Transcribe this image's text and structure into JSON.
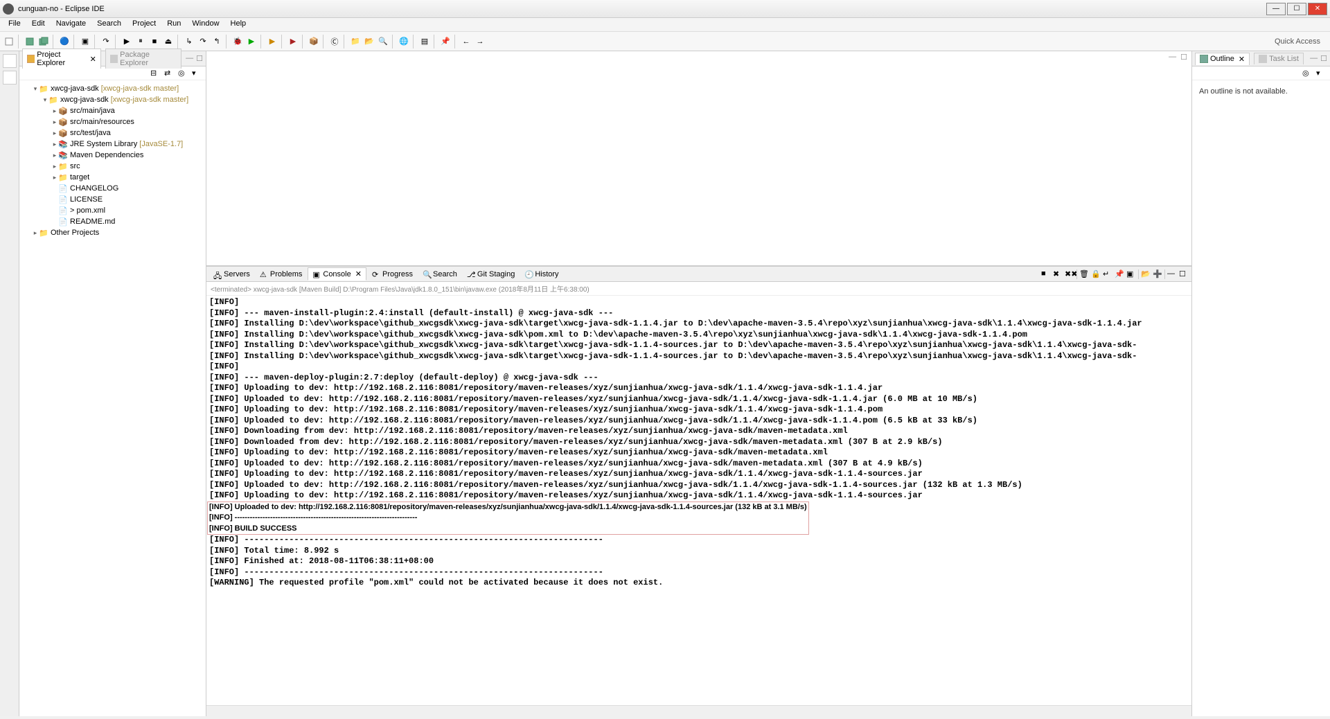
{
  "title": "cunguan-no - Eclipse IDE",
  "menu": [
    "File",
    "Edit",
    "Navigate",
    "Search",
    "Project",
    "Run",
    "Window",
    "Help"
  ],
  "quickAccess": "Quick Access",
  "leftTabs": {
    "projectExplorer": "Project Explorer",
    "packageExplorer": "Package Explorer"
  },
  "tree": {
    "proj1": "xwcg-java-sdk",
    "proj1b": "[xwcg-java-sdk master]",
    "proj2": "xwcg-java-sdk",
    "proj2b": "[xwcg-java-sdk master]",
    "srcMainJava": "src/main/java",
    "srcMainRes": "src/main/resources",
    "srcTestJava": "src/test/java",
    "jre": "JRE System Library",
    "jreb": "[JavaSE-1.7]",
    "maven": "Maven Dependencies",
    "src": "src",
    "target": "target",
    "changelog": "CHANGELOG",
    "license": "LICENSE",
    "pom": "> pom.xml",
    "readme": "README.md",
    "other": "Other Projects"
  },
  "ctabs": {
    "servers": "Servers",
    "problems": "Problems",
    "console": "Console",
    "progress": "Progress",
    "search": "Search",
    "git": "Git Staging",
    "history": "History"
  },
  "terminated": "<terminated> xwcg-java-sdk [Maven Build] D:\\Program Files\\Java\\jdk1.8.0_151\\bin\\javaw.exe (2018年8月11日 上午6:38:00)",
  "lines": [
    "[INFO]",
    "[INFO] --- maven-install-plugin:2.4:install (default-install) @ xwcg-java-sdk ---",
    "[INFO] Installing D:\\dev\\workspace\\github_xwcgsdk\\xwcg-java-sdk\\target\\xwcg-java-sdk-1.1.4.jar to D:\\dev\\apache-maven-3.5.4\\repo\\xyz\\sunjianhua\\xwcg-java-sdk\\1.1.4\\xwcg-java-sdk-1.1.4.jar",
    "[INFO] Installing D:\\dev\\workspace\\github_xwcgsdk\\xwcg-java-sdk\\pom.xml to D:\\dev\\apache-maven-3.5.4\\repo\\xyz\\sunjianhua\\xwcg-java-sdk\\1.1.4\\xwcg-java-sdk-1.1.4.pom",
    "[INFO] Installing D:\\dev\\workspace\\github_xwcgsdk\\xwcg-java-sdk\\target\\xwcg-java-sdk-1.1.4-sources.jar to D:\\dev\\apache-maven-3.5.4\\repo\\xyz\\sunjianhua\\xwcg-java-sdk\\1.1.4\\xwcg-java-sdk-",
    "[INFO] Installing D:\\dev\\workspace\\github_xwcgsdk\\xwcg-java-sdk\\target\\xwcg-java-sdk-1.1.4-sources.jar to D:\\dev\\apache-maven-3.5.4\\repo\\xyz\\sunjianhua\\xwcg-java-sdk\\1.1.4\\xwcg-java-sdk-",
    "[INFO]",
    "[INFO] --- maven-deploy-plugin:2.7:deploy (default-deploy) @ xwcg-java-sdk ---",
    "[INFO] Uploading to dev: http://192.168.2.116:8081/repository/maven-releases/xyz/sunjianhua/xwcg-java-sdk/1.1.4/xwcg-java-sdk-1.1.4.jar",
    "[INFO] Uploaded to dev: http://192.168.2.116:8081/repository/maven-releases/xyz/sunjianhua/xwcg-java-sdk/1.1.4/xwcg-java-sdk-1.1.4.jar (6.0 MB at 10 MB/s)",
    "[INFO] Uploading to dev: http://192.168.2.116:8081/repository/maven-releases/xyz/sunjianhua/xwcg-java-sdk/1.1.4/xwcg-java-sdk-1.1.4.pom",
    "[INFO] Uploaded to dev: http://192.168.2.116:8081/repository/maven-releases/xyz/sunjianhua/xwcg-java-sdk/1.1.4/xwcg-java-sdk-1.1.4.pom (6.5 kB at 33 kB/s)",
    "[INFO] Downloading from dev: http://192.168.2.116:8081/repository/maven-releases/xyz/sunjianhua/xwcg-java-sdk/maven-metadata.xml",
    "[INFO] Downloaded from dev: http://192.168.2.116:8081/repository/maven-releases/xyz/sunjianhua/xwcg-java-sdk/maven-metadata.xml (307 B at 2.9 kB/s)",
    "[INFO] Uploading to dev: http://192.168.2.116:8081/repository/maven-releases/xyz/sunjianhua/xwcg-java-sdk/maven-metadata.xml",
    "[INFO] Uploaded to dev: http://192.168.2.116:8081/repository/maven-releases/xyz/sunjianhua/xwcg-java-sdk/maven-metadata.xml (307 B at 4.9 kB/s)",
    "[INFO] Uploading to dev: http://192.168.2.116:8081/repository/maven-releases/xyz/sunjianhua/xwcg-java-sdk/1.1.4/xwcg-java-sdk-1.1.4-sources.jar",
    "[INFO] Uploaded to dev: http://192.168.2.116:8081/repository/maven-releases/xyz/sunjianhua/xwcg-java-sdk/1.1.4/xwcg-java-sdk-1.1.4-sources.jar (132 kB at 1.3 MB/s)",
    "[INFO] Uploading to dev: http://192.168.2.116:8081/repository/maven-releases/xyz/sunjianhua/xwcg-java-sdk/1.1.4/xwcg-java-sdk-1.1.4-sources.jar"
  ],
  "hlLines": [
    "[INFO] Uploaded to dev: http://192.168.2.116:8081/repository/maven-releases/xyz/sunjianhua/xwcg-java-sdk/1.1.4/xwcg-java-sdk-1.1.4-sources.jar (132 kB at 3.1 MB/s)",
    "[INFO] ------------------------------------------------------------------------",
    "[INFO] BUILD SUCCESS"
  ],
  "linesAfter": [
    "[INFO] ------------------------------------------------------------------------",
    "[INFO] Total time: 8.992 s",
    "[INFO] Finished at: 2018-08-11T06:38:11+08:00",
    "[INFO] ------------------------------------------------------------------------",
    "[WARNING] The requested profile \"pom.xml\" could not be activated because it does not exist."
  ],
  "outline": {
    "tab": "Outline",
    "task": "Task List",
    "msg": "An outline is not available."
  }
}
